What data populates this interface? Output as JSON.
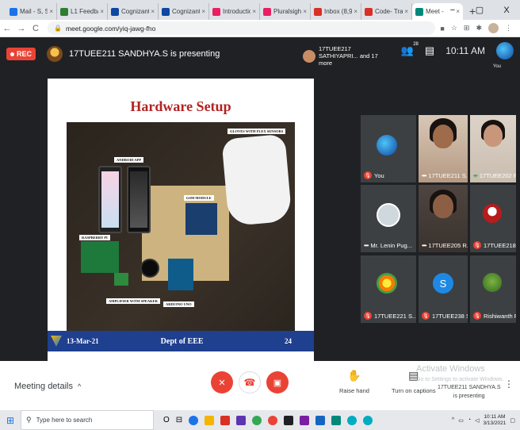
{
  "browser": {
    "tabs": [
      {
        "label": "Mail - S, Sr",
        "color": "#1a73e8"
      },
      {
        "label": "L1 Feedbac",
        "color": "#2e7d32"
      },
      {
        "label": "Cognizant",
        "color": "#0d47a1"
      },
      {
        "label": "Cognizant",
        "color": "#0d47a1"
      },
      {
        "label": "Introductio",
        "color": "#e91e63"
      },
      {
        "label": "Pluralsight",
        "color": "#e91e63"
      },
      {
        "label": "Inbox (8,9",
        "color": "#d93025"
      },
      {
        "label": "Code- Trai",
        "color": "#d93025"
      },
      {
        "label": "Meet -",
        "color": "#00897b"
      }
    ],
    "new_tab": "+",
    "win_min": "−",
    "win_max": "▢",
    "win_close": "X",
    "url": "meet.google.com/yiq-jawg-fho"
  },
  "meet_top": {
    "rec_label": "REC",
    "presenting": "17TUEE211 SANDHYA.S is presenting",
    "people_text": "17TUEE217 SATHIYAPRI... and 17 more",
    "people_count": "28",
    "clock": "10:11 AM",
    "you_label": "You"
  },
  "slide": {
    "title": "Hardware Setup",
    "labels": {
      "android": "ANDROID APP",
      "gloves": "GLOVES WITH FLEX SENSORS",
      "gsm": "GSM MODULE",
      "raspberry": "RASPBERRY PI",
      "amplifier": "AMPLIFIER WITH SPEAKER",
      "arduino": "ARDUINO UNO"
    },
    "footer_date": "13-Mar-21",
    "footer_dept": "Dept of EEE",
    "footer_page": "24"
  },
  "tiles": [
    {
      "name": "You",
      "type": "avatar"
    },
    {
      "name": "17TUEE211 S...",
      "type": "video"
    },
    {
      "name": "17TUEE202 R...",
      "type": "video"
    },
    {
      "name": "Mr. Lenin Pug...",
      "type": "avatar"
    },
    {
      "name": "17TUEE205 R...",
      "type": "video"
    },
    {
      "name": "17TUEE218 S...",
      "type": "avatar"
    },
    {
      "name": "17TUEE221 S...",
      "type": "avatar"
    },
    {
      "name": "17TUEE238 S...",
      "type": "avatar"
    },
    {
      "name": "Rishiwanth R",
      "type": "avatar"
    }
  ],
  "controls": {
    "meeting_details": "Meeting details",
    "raise_hand": "Raise hand",
    "captions": "Turn on captions",
    "watermark_title": "Activate Windows",
    "watermark_sub": "Go to Settings to activate Windows.",
    "presenting_chip": "17TUEE211 SANDHYA.S",
    "presenting_chip2": "is presenting"
  },
  "taskbar": {
    "search_placeholder": "Type here to search",
    "time": "10:11 AM",
    "date": "3/13/2021"
  }
}
